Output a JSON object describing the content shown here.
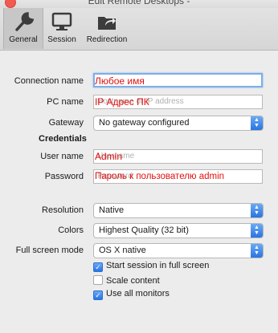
{
  "window": {
    "title": "Edit Remote Desktops -"
  },
  "toolbar": {
    "tabs": [
      {
        "label": "General",
        "icon": "wrench-icon",
        "active": true
      },
      {
        "label": "Session",
        "icon": "monitor-icon",
        "active": false
      },
      {
        "label": "Redirection",
        "icon": "folder-share-icon",
        "active": false
      }
    ]
  },
  "form": {
    "connection_name": {
      "label": "Connection name",
      "value": "",
      "annotation": "Любое имя"
    },
    "pc_name": {
      "label": "PC name",
      "placeholder": "Hostname or IP address",
      "annotation": "IP Адрес ПК"
    },
    "gateway": {
      "label": "Gateway",
      "value": "No gateway configured"
    },
    "credentials_heading": "Credentials",
    "user_name": {
      "label": "User name",
      "placeholder": "Username",
      "annotation": "Admin"
    },
    "password": {
      "label": "Password",
      "placeholder": "Password",
      "annotation": "Пароль к пользователю admin"
    },
    "resolution": {
      "label": "Resolution",
      "value": "Native"
    },
    "colors": {
      "label": "Colors",
      "value": "Highest Quality (32 bit)"
    },
    "full_screen_mode": {
      "label": "Full screen mode",
      "value": "OS X native"
    },
    "checkboxes": [
      {
        "label": "Start session in full screen",
        "checked": true
      },
      {
        "label": "Scale content",
        "checked": false
      },
      {
        "label": "Use all monitors",
        "checked": true
      }
    ]
  },
  "colors": {
    "annotation": "#e01010",
    "accent": "#2a74e0"
  }
}
